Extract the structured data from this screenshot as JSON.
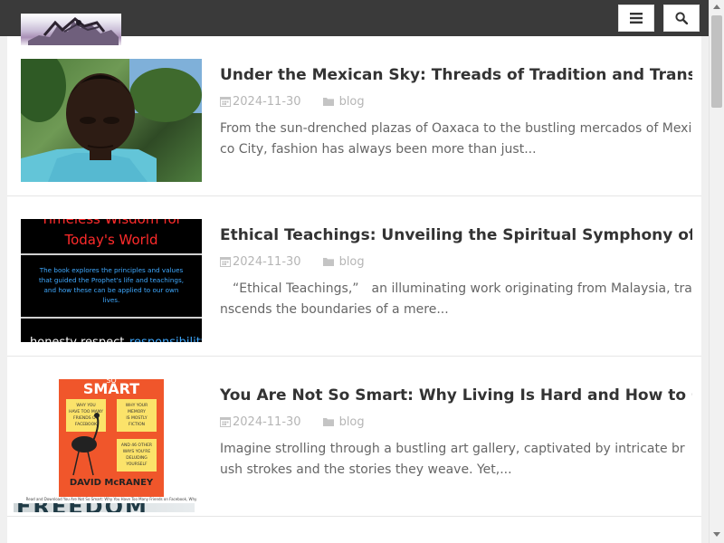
{
  "header": {
    "logo_icon": "site-logo-image",
    "menu_icon": "menu-icon",
    "search_icon": "search-icon"
  },
  "posts": [
    {
      "title": "Under the Mexican Sky: Threads of Tradition and Transformatio",
      "date": "2024-11-30",
      "category": "blog",
      "excerpt": "From the sun-drenched plazas of Oaxaca to the bustling mercados of Mexico City, fashion has always been more than just..."
    },
    {
      "title": "Ethical Teachings: Unveiling the Spiritual Symphony of Islam",
      "date": "2024-11-30",
      "category": "blog",
      "excerpt": "　“Ethical Teachings,”　an illuminating work originating from Malaysia, transcends the boundaries of a mere...",
      "thumb": {
        "heading_line1": "Timeless Wisdom for",
        "heading_line2": "Today's World",
        "body_line1": "The book explores the principles and values",
        "body_line2": "that guided the Prophet's life and teachings,",
        "body_line3": "and how these can be applied to our own",
        "body_line4": "lives.",
        "footer_1": "honesty",
        "footer_2": "respect",
        "footer_3": "responsibility"
      }
    },
    {
      "title": "You Are Not So Smart: Why Living Is Hard and How to Get Bette",
      "date": "2024-11-30",
      "category": "blog",
      "excerpt": "Imagine strolling through a bustling art gallery, captivated by intricate brush strokes and the stories they weave. Yet,...",
      "thumb": {
        "top": "SO",
        "title": "SMART",
        "bubble1_l1": "WHY YOU",
        "bubble1_l2": "HAVE TOO MANY",
        "bubble1_l3": "FRIENDS ON",
        "bubble1_l4": "FACEBOOK",
        "bubble2_l1": "WHY YOUR",
        "bubble2_l2": "MEMORY",
        "bubble2_l3": "IS MOSTLY",
        "bubble2_l4": "FICTION",
        "bubble3_l1": "AND 46 OTHER",
        "bubble3_l2": "WAYS YOU'RE",
        "bubble3_l3": "DELUDING",
        "bubble3_l4": "YOURSELF",
        "author": "DAVID McRANEY",
        "caption": "Read and Download You Are Not So Smart: Why You Have Too Many Friends on Facebook, Why"
      }
    }
  ],
  "next_post_thumb_text": "FREEDOM"
}
